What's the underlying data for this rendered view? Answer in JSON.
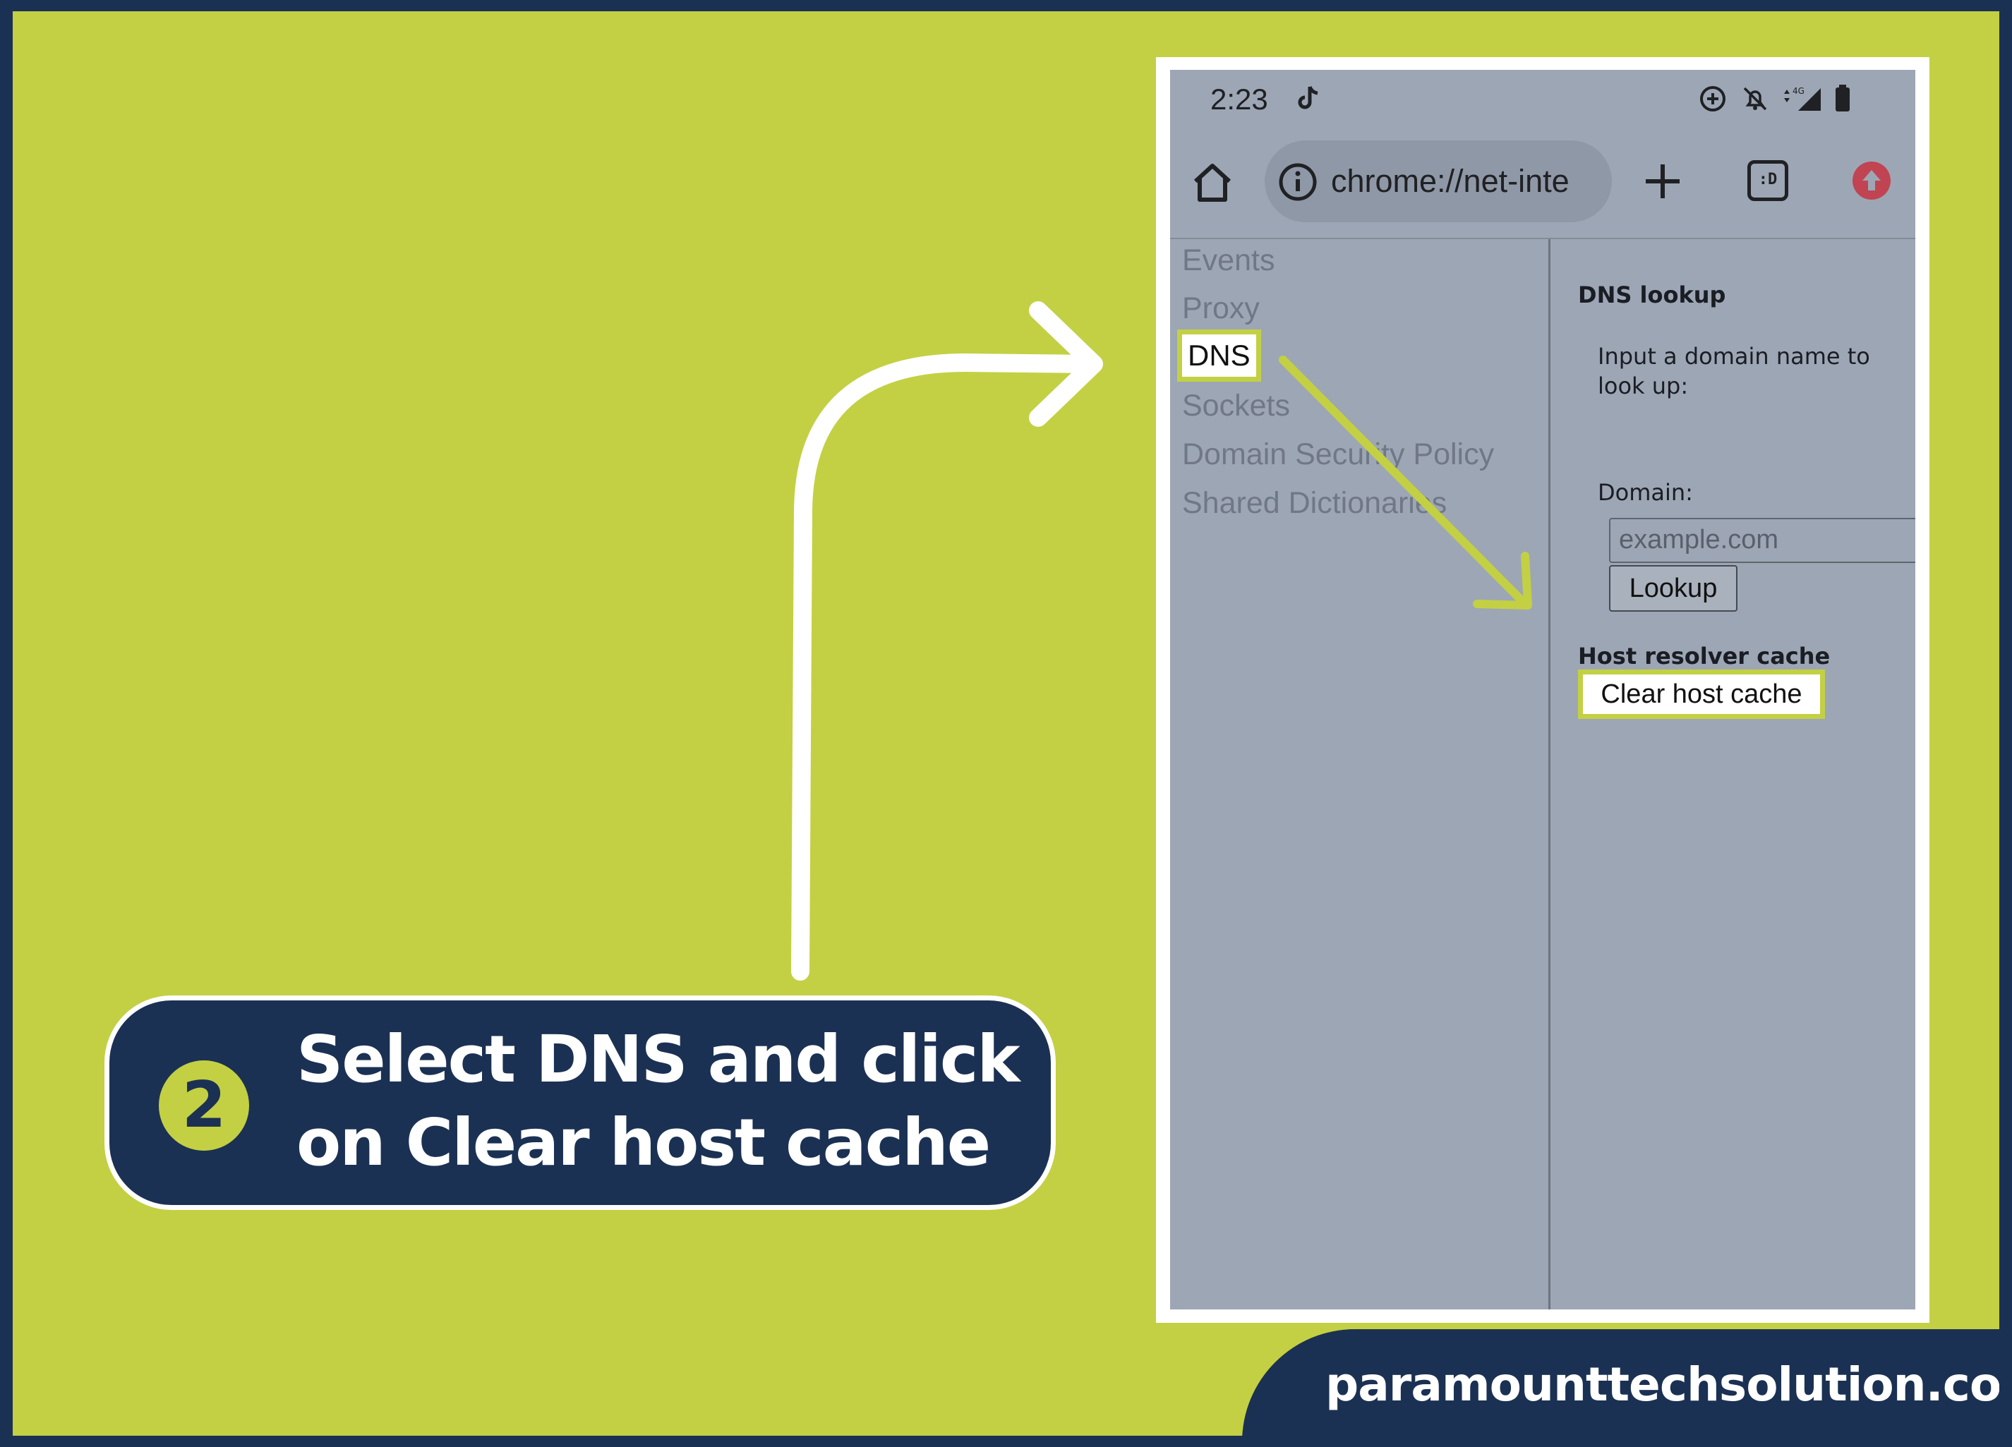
{
  "status_bar": {
    "time": "2:23",
    "network": "4G",
    "icons": [
      "tiktok-icon",
      "data-saver-icon",
      "mute-bell-icon",
      "signal-icon",
      "battery-icon"
    ]
  },
  "browser": {
    "url": "chrome://net-inte",
    "tab_switcher_label": ":D",
    "icons": [
      "home-icon",
      "info-icon",
      "new-tab-icon",
      "tab-switcher-icon",
      "update-icon"
    ]
  },
  "sidebar": {
    "items": [
      {
        "label": "Events"
      },
      {
        "label": "Proxy"
      },
      {
        "label": "DNS",
        "active": true
      },
      {
        "label": "Sockets"
      },
      {
        "label": "Domain Security Policy"
      },
      {
        "label": "Shared Dictionaries"
      }
    ]
  },
  "dns": {
    "lookup_heading": "DNS lookup",
    "lookup_instruction": "Input a domain name to look up:",
    "domain_label": "Domain:",
    "domain_placeholder": "example.com",
    "lookup_button": "Lookup",
    "cache_heading": "Host resolver cache",
    "clear_button": "Clear host cache"
  },
  "callout": {
    "step_number": "2",
    "line1": "Select DNS and click",
    "line2": "on Clear host cache"
  },
  "brand": {
    "site": "paramounttechsolution.com"
  },
  "colors": {
    "background": "#c3d043",
    "navy": "#1b3153",
    "screen_gray": "#9da6b4",
    "highlight": "#c3d043"
  }
}
